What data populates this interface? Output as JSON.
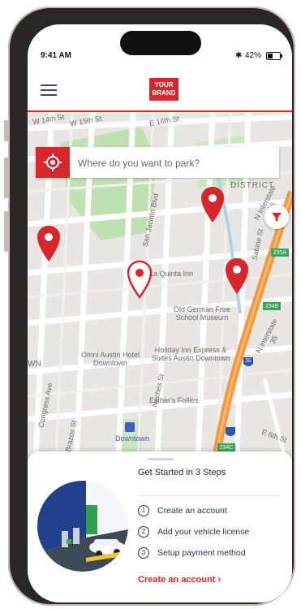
{
  "status_bar": {
    "time": "9:41 AM",
    "bluetooth_icon": "bluetooth-icon",
    "battery_text": "42%",
    "battery_level": 0.42
  },
  "header": {
    "brand_line1": "YOUR",
    "brand_line2": "BRAND",
    "menu_icon": "hamburger-menu-icon"
  },
  "search": {
    "placeholder": "Where do you want to park?"
  },
  "map": {
    "labels": {
      "w14th": "W 14th St",
      "w15th": "W 15th St",
      "e16th": "E 16th St",
      "district": "DISTRICT",
      "san_jacinto": "San Jacinto Blvd",
      "la_quinta": "La Quinta Inn",
      "old_german": "Old German Free School Museum",
      "holiday_inn": "Holiday Inn Express & Suites Austin Downtown",
      "omni": "Omni Austin Hotel Downtown",
      "neches": "Neches St",
      "esthers": "Esther's Follies",
      "downtown": "Downtown",
      "congress": "Congress Ave",
      "brazos": "Brazos St",
      "sabine": "Sabine St",
      "interstate_35_top": "N Interstate 35",
      "interstate_35_mid": "N Interstate 35",
      "e6th": "E 6th St",
      "wn": "WN",
      "i35a": "235A",
      "i234b": "234B",
      "i234c": "234C",
      "shield_35": "35"
    },
    "accent": "#d9262c"
  },
  "onboarding": {
    "title": "Get Started in 3 Steps",
    "steps": [
      {
        "num": "1",
        "label": "Create an account"
      },
      {
        "num": "2",
        "label": "Add your vehicle license"
      },
      {
        "num": "3",
        "label": "Setup payment method"
      }
    ],
    "cta": "Create an account ›"
  }
}
